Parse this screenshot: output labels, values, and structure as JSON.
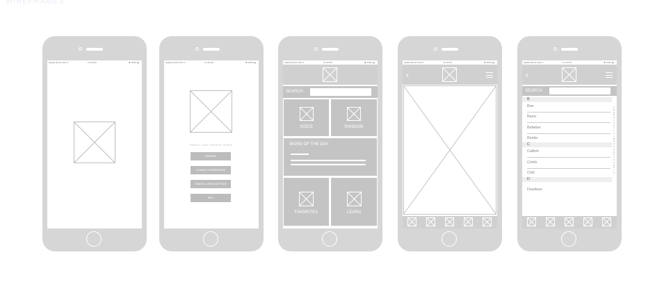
{
  "faint_title": "WIREFRAMES",
  "status": {
    "carrier": "●●●●● 9GAG.GAO ≡",
    "time": "12:46 PM",
    "battery": "✱ 100% ▬"
  },
  "phone2": {
    "tagline": "DWELL AND WEAVE WORK",
    "buttons": [
      "GENERAL",
      "CHANGE COMPARISONS",
      "CHANGE LINKED BUTTONS",
      "INFO"
    ]
  },
  "phone3": {
    "search_label": "SEARCH",
    "tiles": {
      "voice": "VOICE",
      "random": "RANDOM",
      "word_of_day": "WORD OF THE DAY",
      "favorites": "FAVORITES",
      "learn": "LEARN"
    }
  },
  "phone5": {
    "search_label": "SEARCH",
    "sections": [
      {
        "letter": "B",
        "items": [
          "Bae",
          "Basic",
          "Belieber",
          "Bestie"
        ]
      },
      {
        "letter": "C",
        "items": [
          "Catfish",
          "Celeb",
          "Chill"
        ]
      },
      {
        "letter": "D",
        "items": [
          "Deadass"
        ]
      }
    ],
    "index_letters": [
      "A",
      "B",
      "C",
      "D",
      "E",
      "F",
      "G",
      "H",
      "I",
      "J",
      "K",
      "L",
      "M",
      "N",
      "O",
      "P",
      "Q",
      "R",
      "S",
      "T",
      "U",
      "V",
      "W",
      "X",
      "Y",
      "Z"
    ]
  },
  "icons": {
    "back": "chevron-left-icon",
    "menu": "hamburger-menu-icon",
    "placeholder": "image-placeholder-icon"
  }
}
